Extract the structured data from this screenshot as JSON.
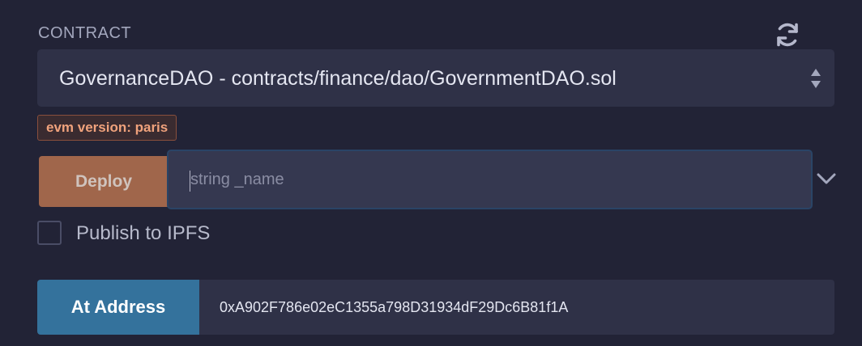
{
  "contract": {
    "section_label": "CONTRACT",
    "selected": "GovernanceDAO - contracts/finance/dao/GovernmentDAO.sol"
  },
  "evm": {
    "badge": "evm version: paris"
  },
  "deploy": {
    "button_label": "Deploy",
    "input_placeholder": "string _name"
  },
  "publish": {
    "label": "Publish to IPFS",
    "checked": false
  },
  "at_address": {
    "button_label": "At Address",
    "value": "0xA902F786e02eC1355a798D31934dF29Dc6B81f1A"
  },
  "icons": {
    "refresh": "refresh-icon",
    "select_arrows": "sort-arrows-icon",
    "expand": "chevron-down-icon"
  },
  "colors": {
    "background": "#222336",
    "deploy_button": "#a0664b",
    "at_address_button": "#34729c",
    "badge_text": "#f0a27c"
  }
}
